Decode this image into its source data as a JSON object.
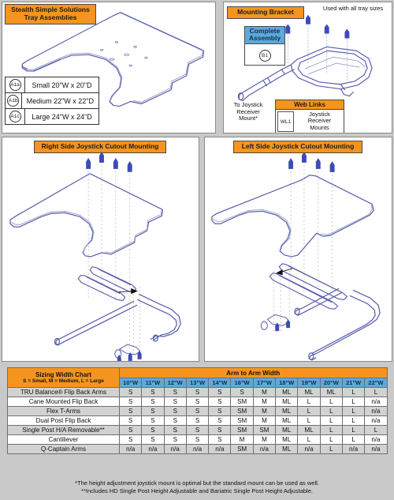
{
  "panels": {
    "tray": {
      "title": "Stealth Simple Solutions\nTray Assemblies",
      "title_line1": "Stealth Simple Solutions",
      "title_line2": "Tray Assemblies",
      "legend": [
        {
          "code": "A1a",
          "label": "Small 20\"W x 20\"D"
        },
        {
          "code": "A1b",
          "label": "Medium 22\"W x 22\"D"
        },
        {
          "code": "A1c",
          "label": "Large 24\"W x 24\"D"
        }
      ]
    },
    "bracket": {
      "title": "Mounting Bracket",
      "used_with": "Used with all tray sizes",
      "complete_assembly": {
        "line1": "Complete",
        "line2": "Assembly",
        "code": "B1"
      },
      "to_joystick": "To Joystick\nReceiver\nMount*",
      "to_joystick_l1": "To Joystick",
      "to_joystick_l2": "Receiver",
      "to_joystick_l3": "Mount*",
      "web_links": {
        "header": "Web Links",
        "code": "WL1",
        "text_l1": "Joystick Receiver",
        "text_l2": "Mounts"
      }
    },
    "right_side": {
      "title": "Right Side Joystick Cutout Mounting"
    },
    "left_side": {
      "title": "Left Side Joystick Cutout Mounting"
    }
  },
  "chart_data": {
    "type": "table",
    "title": "Sizing Width Chart",
    "subtitle": "S = Small, M = Medium, L = Large",
    "group_header": "Arm to Arm Width",
    "categories": [
      "10\"W",
      "11\"W",
      "12\"W",
      "13\"W",
      "14\"W",
      "16\"W",
      "17\"W",
      "18\"W",
      "19\"W",
      "20\"W",
      "21\"W",
      "22\"W"
    ],
    "rows": [
      {
        "label": "TRU Balance® Flip Back Arms",
        "values": [
          "S",
          "S",
          "S",
          "S",
          "S",
          "S",
          "M",
          "ML",
          "ML",
          "ML",
          "L",
          "L"
        ]
      },
      {
        "label": "Cane Mounted Flip Back",
        "values": [
          "S",
          "S",
          "S",
          "S",
          "S",
          "SM",
          "M",
          "ML",
          "L",
          "L",
          "L",
          "n/a"
        ]
      },
      {
        "label": "Flex T-Arms",
        "values": [
          "S",
          "S",
          "S",
          "S",
          "S",
          "SM",
          "M",
          "ML",
          "L",
          "L",
          "L",
          "n/a"
        ]
      },
      {
        "label": "Dual Post Flip Back",
        "values": [
          "S",
          "S",
          "S",
          "S",
          "S",
          "SM",
          "M",
          "ML",
          "L",
          "L",
          "L",
          "n/a"
        ]
      },
      {
        "label": "Single Post H/A Removable**",
        "values": [
          "S",
          "S",
          "S",
          "S",
          "S",
          "SM",
          "SM",
          "ML",
          "ML",
          "L",
          "L",
          "L"
        ]
      },
      {
        "label": "Cantiliever",
        "values": [
          "S",
          "S",
          "S",
          "S",
          "S",
          "M",
          "M",
          "ML",
          "L",
          "L",
          "L",
          "n/a"
        ]
      },
      {
        "label": "Q-Captain Arms",
        "values": [
          "n/a",
          "n/a",
          "n/a",
          "n/a",
          "n/a",
          "SM",
          "n/a",
          "ML",
          "n/a",
          "L",
          "n/a",
          "n/a"
        ]
      }
    ]
  },
  "footnotes": {
    "one": "*The height adjustment joystick mount is optimal but the standard mount can be used as well.",
    "two": "**Includes HD Single Post Height Adjustable and Bariatric Single Post Height Adjustable."
  },
  "colors": {
    "orange": "#F5941F",
    "blue": "#5BA9DD",
    "line": "#5a5fae",
    "page_bg": "#c9c9c9"
  }
}
